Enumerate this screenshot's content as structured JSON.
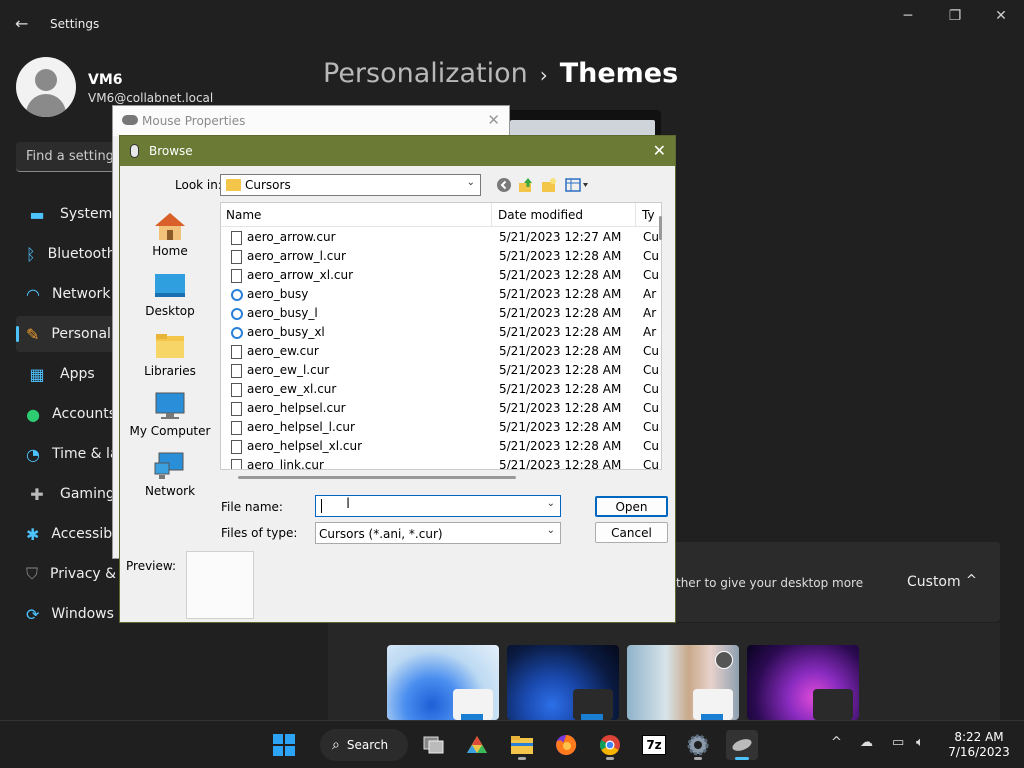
{
  "settings": {
    "window_title": "Settings",
    "back_icon": "arrow-left-icon",
    "user": {
      "name": "VM6",
      "email": "VM6@collabnet.local"
    },
    "search_placeholder": "Find a setting",
    "nav": [
      {
        "label": "System",
        "icon": "monitor-icon",
        "color": "#4cc2ff"
      },
      {
        "label": "Bluetooth & devices",
        "icon": "bluetooth-icon",
        "color": "#4cc2ff"
      },
      {
        "label": "Network & internet",
        "icon": "wifi-icon",
        "color": "#4cc2ff"
      },
      {
        "label": "Personalization",
        "icon": "brush-icon",
        "color": "#f0a030"
      },
      {
        "label": "Apps",
        "icon": "apps-icon",
        "color": "#4cc2ff"
      },
      {
        "label": "Accounts",
        "icon": "person-icon",
        "color": "#2ecc71"
      },
      {
        "label": "Time & language",
        "icon": "globe-clock-icon",
        "color": "#4cc2ff"
      },
      {
        "label": "Gaming",
        "icon": "gamepad-icon",
        "color": "#bbbbbb"
      },
      {
        "label": "Accessibility",
        "icon": "accessibility-icon",
        "color": "#4cc2ff"
      },
      {
        "label": "Privacy & security",
        "icon": "shield-icon",
        "color": "#888888"
      },
      {
        "label": "Windows Update",
        "icon": "sync-icon",
        "color": "#4cc2ff"
      }
    ],
    "breadcrumb": {
      "parent": "Personalization",
      "separator": "›",
      "current": "Themes"
    },
    "custom_row": {
      "description": "ther to give your desktop more",
      "value": "Custom",
      "chevron": "^"
    }
  },
  "mouse_properties": {
    "title": "Mouse Properties",
    "close": "✕"
  },
  "browse": {
    "title": "Browse",
    "close": "✕",
    "look_in_label": "Look in:",
    "look_in_value": "Cursors",
    "places": [
      "Home",
      "Desktop",
      "Libraries",
      "My Computer",
      "Network"
    ],
    "columns": [
      "Name",
      "Date modified",
      "Ty"
    ],
    "files": [
      {
        "name": "aero_arrow.cur",
        "date": "5/21/2023 12:27 AM",
        "type": "Cu",
        "kind": "cur"
      },
      {
        "name": "aero_arrow_l.cur",
        "date": "5/21/2023 12:28 AM",
        "type": "Cu",
        "kind": "cur"
      },
      {
        "name": "aero_arrow_xl.cur",
        "date": "5/21/2023 12:28 AM",
        "type": "Cu",
        "kind": "cur"
      },
      {
        "name": "aero_busy",
        "date": "5/21/2023 12:28 AM",
        "type": "Ar",
        "kind": "ani"
      },
      {
        "name": "aero_busy_l",
        "date": "5/21/2023 12:28 AM",
        "type": "Ar",
        "kind": "ani"
      },
      {
        "name": "aero_busy_xl",
        "date": "5/21/2023 12:28 AM",
        "type": "Ar",
        "kind": "ani"
      },
      {
        "name": "aero_ew.cur",
        "date": "5/21/2023 12:28 AM",
        "type": "Cu",
        "kind": "cur"
      },
      {
        "name": "aero_ew_l.cur",
        "date": "5/21/2023 12:28 AM",
        "type": "Cu",
        "kind": "cur"
      },
      {
        "name": "aero_ew_xl.cur",
        "date": "5/21/2023 12:28 AM",
        "type": "Cu",
        "kind": "cur"
      },
      {
        "name": "aero_helpsel.cur",
        "date": "5/21/2023 12:28 AM",
        "type": "Cu",
        "kind": "cur"
      },
      {
        "name": "aero_helpsel_l.cur",
        "date": "5/21/2023 12:28 AM",
        "type": "Cu",
        "kind": "cur"
      },
      {
        "name": "aero_helpsel_xl.cur",
        "date": "5/21/2023 12:28 AM",
        "type": "Cu",
        "kind": "cur"
      },
      {
        "name": "aero_link.cur",
        "date": "5/21/2023 12:28 AM",
        "type": "Cu",
        "kind": "cur"
      }
    ],
    "file_name_label": "File name:",
    "file_name_value": "",
    "files_of_type_label": "Files of type:",
    "files_of_type_value": "Cursors (*.ani, *.cur)",
    "open_label": "Open",
    "cancel_label": "Cancel",
    "preview_label": "Preview:"
  },
  "taskbar": {
    "search_label": "Search",
    "time": "8:22 AM",
    "date": "7/16/2023",
    "apps": [
      "task-view-icon",
      "photos-icon",
      "file-explorer-icon",
      "firefox-icon",
      "chrome-icon",
      "7zip-icon",
      "settings-gear-icon",
      "mouse-icon"
    ],
    "seven_zip_text": "7z"
  }
}
